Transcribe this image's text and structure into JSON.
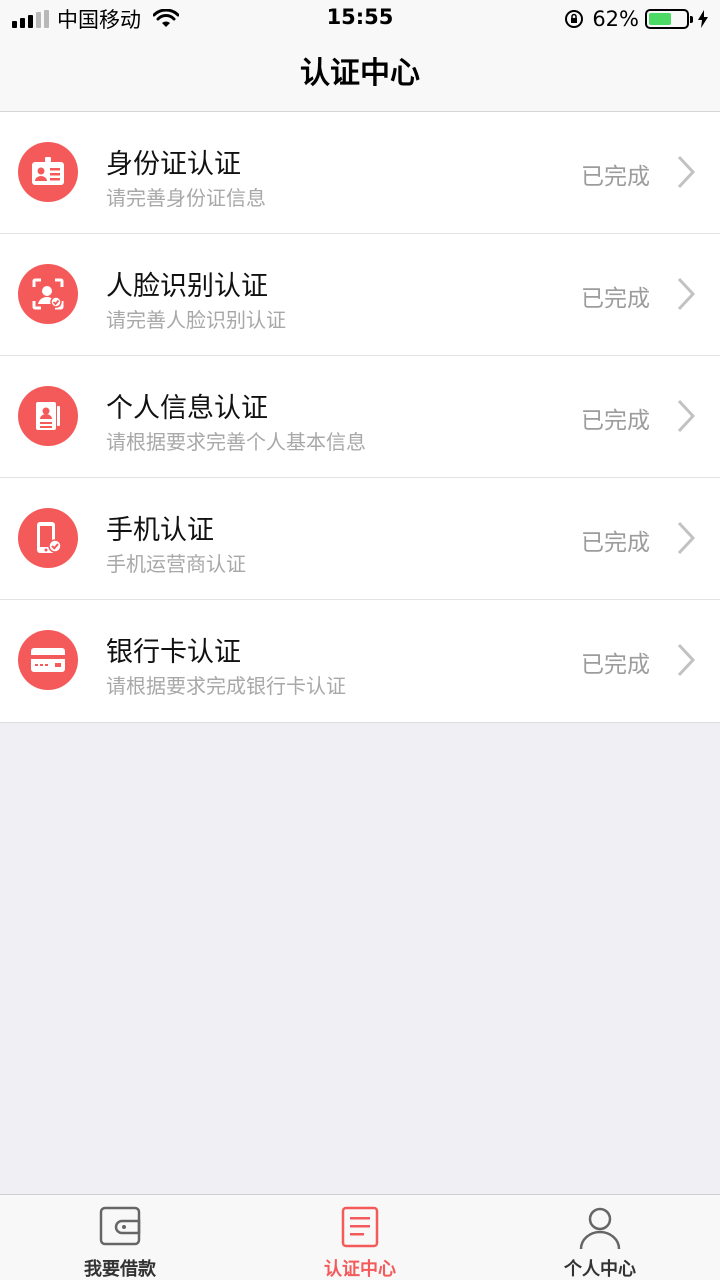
{
  "status_bar": {
    "carrier": "中国移动",
    "time": "15:55",
    "battery_pct": "62%",
    "battery_level": 0.62,
    "battery_color": "#4cd964"
  },
  "nav": {
    "title": "认证中心"
  },
  "colors": {
    "accent": "#f55a5a",
    "subtext": "#a8a8a8",
    "status": "#9c9c9c"
  },
  "items": [
    {
      "icon": "id-card-icon",
      "title": "身份证认证",
      "subtitle": "请完善身份证信息",
      "status": "已完成"
    },
    {
      "icon": "face-scan-icon",
      "title": "人脸识别认证",
      "subtitle": "请完善人脸识别认证",
      "status": "已完成"
    },
    {
      "icon": "personal-info-icon",
      "title": "个人信息认证",
      "subtitle": "请根据要求完善个人基本信息",
      "status": "已完成"
    },
    {
      "icon": "phone-check-icon",
      "title": "手机认证",
      "subtitle": "手机运营商认证",
      "status": "已完成"
    },
    {
      "icon": "bank-card-icon",
      "title": "银行卡认证",
      "subtitle": "请根据要求完成银行卡认证",
      "status": "已完成"
    }
  ],
  "tabs": [
    {
      "icon": "wallet-icon",
      "label": "我要借款",
      "active": false
    },
    {
      "icon": "document-list-icon",
      "label": "认证中心",
      "active": true
    },
    {
      "icon": "person-icon",
      "label": "个人中心",
      "active": false
    }
  ]
}
